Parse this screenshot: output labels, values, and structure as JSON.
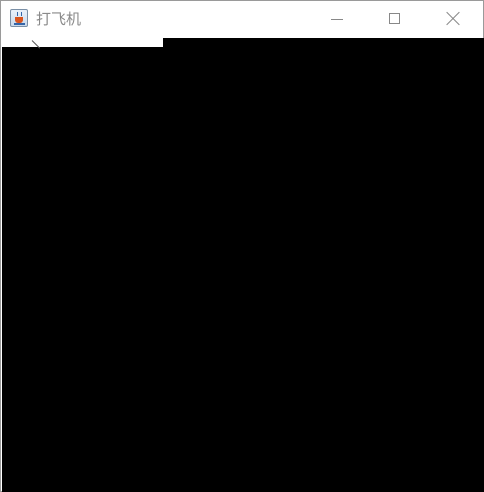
{
  "window": {
    "title": "打飞机",
    "app_icon": "java-cup-icon"
  },
  "controls": {
    "minimize_icon": "minimize-icon",
    "maximize_icon": "maximize-icon",
    "close_icon": "close-icon"
  },
  "game": {
    "background_color": "#000000",
    "hud_strip_color": "#ffffff"
  }
}
